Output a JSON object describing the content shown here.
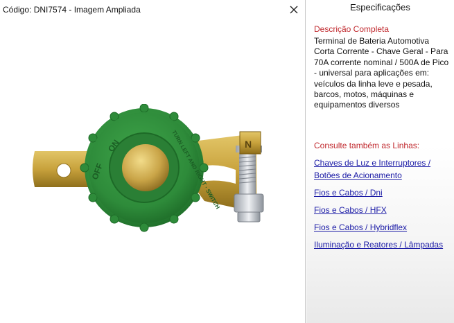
{
  "window": {
    "title": "Código: DNI7574 - Imagem Ampliada",
    "close_icon": "close-icon"
  },
  "image": {
    "subject": "battery-cutoff-switch-terminal",
    "knob_text_left": "OFF",
    "knob_text_top": "ON",
    "knob_text_edge": "TURN LEFT AND RIGHT · SWITCH",
    "nut_letter": "N",
    "colors": {
      "knob": "#2e8b3a",
      "brass": "#c8a23c"
    }
  },
  "specs": {
    "header": "Especificações",
    "description_title": "Descrição Completa",
    "description_text": "Terminal de Bateria Automotiva Corta Corrente - Chave Geral - Para 70A corrente nominal / 500A de Pico - universal para aplicações em: veículos da linha leve e pesada, barcos, motos, máquinas e equipamentos diversos",
    "consult_title": "Consulte também as Linhas:",
    "links": [
      "Chaves de Luz e Interruptores / Botões de Acionamento",
      "Fios e Cabos / Dni",
      "Fios e Cabos / HFX",
      "Fios e Cabos / Hybridflex",
      "Iluminação e Reatores / Lâmpadas"
    ],
    "colors": {
      "section_title": "#c0282d",
      "link": "#1a1aa6"
    }
  }
}
